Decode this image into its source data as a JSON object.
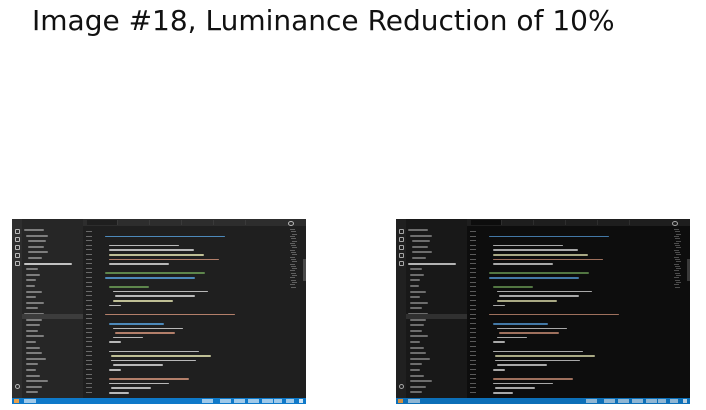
{
  "page": {
    "title": "Image #18, Luminance Reduction of 10%"
  },
  "screenshots": [
    {
      "id": "left",
      "colors": {
        "titlebar": "#3a3a3a",
        "activity": "#2e2e2e",
        "explorer": "#262626",
        "editor": "#1f1f1f",
        "tabbar": "#2d2d2d",
        "tab_active": "#1f1f1f",
        "tree_text": "#b8b8b8",
        "tree_sel": "#3c3c3c",
        "gutter": "#6a6a6a",
        "code": "#d4d4d4",
        "keyword": "#569cd6",
        "string": "#ce9178",
        "func": "#dcdcaa",
        "comment": "#6a9955",
        "minimap": "#7a7a7a",
        "scroll": "#4a4a4a",
        "status": "#0e79c9",
        "status_icon": "#ffffff",
        "accent": "#e8a04c"
      }
    },
    {
      "id": "right",
      "colors": {
        "titlebar": "#2e2e2e",
        "activity": "#202020",
        "explorer": "#181818",
        "editor": "#0d0d0d",
        "tabbar": "#1e1e1e",
        "tab_active": "#0d0d0d",
        "tree_text": "#a6a6a6",
        "tree_sel": "#303030",
        "gutter": "#5a5a5a",
        "code": "#c4c4c4",
        "keyword": "#4d8cc2",
        "string": "#b9836c",
        "func": "#c6c69a",
        "comment": "#5f894c",
        "minimap": "#6a6a6a",
        "scroll": "#3a3a3a",
        "status": "#0c6fb8",
        "status_icon": "#e6e6e6",
        "accent": "#d19042"
      }
    }
  ]
}
